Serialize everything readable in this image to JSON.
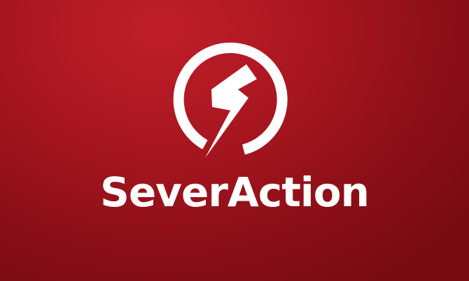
{
  "brand": {
    "name": "SeverAction",
    "logo_icon": "lightning-bolt-in-ring-icon",
    "background_color": "#a8161f",
    "foreground_color": "#ffffff"
  }
}
